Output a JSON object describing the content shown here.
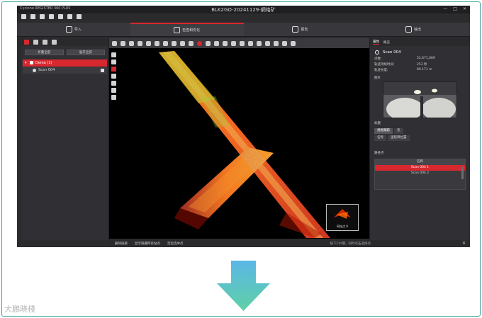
{
  "window": {
    "app_name": "Cyclone REGISTER 360 PLUS",
    "doc_title": "BLK2GO-20241129-網格矿",
    "win_buttons": [
      "—",
      "□",
      "×"
    ]
  },
  "steps": [
    {
      "label": "导入",
      "active": false
    },
    {
      "label": "检查和优化",
      "active": true
    },
    {
      "label": "报告",
      "active": false
    },
    {
      "label": "输出",
      "active": false
    }
  ],
  "left_panel": {
    "buttons": [
      "折叠全部",
      "展开全部"
    ],
    "tree_root": "Demo (1)",
    "tree_scan": "Scan 004"
  },
  "viewport": {
    "thumbnail_label": "网站点 0"
  },
  "status_bar": {
    "items": [
      "删除链接",
      "显示隐藏所有站点",
      "定位选中点"
    ],
    "hint": "按下Ctrl键，同时点击选择点"
  },
  "right_panel": {
    "tabs": [
      "属性",
      "概览"
    ],
    "scan_title": "Scan 004",
    "properties": [
      {
        "key": "点数:",
        "value": "52,671,069"
      },
      {
        "key": "轨迹持续时间:",
        "value": "253 秒"
      },
      {
        "key": "轨迹长度:",
        "value": "89.171 m"
      }
    ],
    "image_section": "图片",
    "label_section": "标题",
    "subtabs": [
      "视觉跟踪",
      "流"
    ],
    "subrow": [
      "名称",
      "里程碑位置"
    ],
    "path_section": "路径点",
    "path_header": "名称",
    "path_items": [
      {
        "label": "Scan 004 1",
        "selected": true
      },
      {
        "label": "Scan 004 2",
        "selected": false
      }
    ]
  },
  "watermark": "大鵬晓棧",
  "colors": {
    "accent": "#d8282f",
    "arrow_top": "#5bb7e6",
    "arrow_bottom": "#5fd0a6",
    "frame_border": "#3aa39d"
  }
}
